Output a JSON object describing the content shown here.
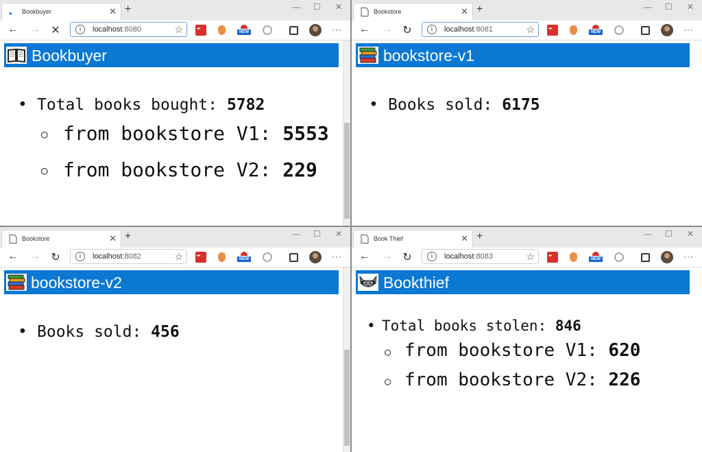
{
  "windows": [
    {
      "id": "bookbuyer",
      "tab_title": "Bookbuyer",
      "url_host": "localhost",
      "url_port": ":8080",
      "banner_title": "Bookbuyer",
      "banner_icon": "book-icon",
      "nav_state": "loading",
      "lines": [
        {
          "label": "Total books bought: ",
          "value": "5782"
        },
        {
          "label": "from bookstore V1: ",
          "value": "5553"
        },
        {
          "label": "from bookstore V2: ",
          "value": "229"
        }
      ]
    },
    {
      "id": "bookstore-v1",
      "tab_title": "Bookstore",
      "url_host": "localhost",
      "url_port": ":8081",
      "banner_title": "bookstore-v1",
      "banner_icon": "books-stack-icon",
      "nav_state": "idle",
      "lines": [
        {
          "label": "Books sold: ",
          "value": "6175"
        }
      ]
    },
    {
      "id": "bookstore-v2",
      "tab_title": "Bookstore",
      "url_host": "localhost",
      "url_port": ":8082",
      "banner_title": "bookstore-v2",
      "banner_icon": "books-stack-icon",
      "nav_state": "idle",
      "lines": [
        {
          "label": "Books sold: ",
          "value": "456"
        }
      ]
    },
    {
      "id": "bookthief",
      "tab_title": "Book Thief",
      "url_host": "localhost",
      "url_port": ":8083",
      "banner_title": "Bookthief",
      "banner_icon": "raccoon-icon",
      "nav_state": "idle",
      "lines": [
        {
          "label": "Total books stolen: ",
          "value": "846"
        },
        {
          "label": "from bookstore V1: ",
          "value": "620"
        },
        {
          "label": "from bookstore V2: ",
          "value": "226"
        }
      ]
    }
  ],
  "toolbar": {
    "new_badge": "NEW",
    "new_tab_symbol": "+",
    "menu_symbol": "···"
  },
  "colors": {
    "banner": "#0b78d4",
    "banner_text": "#ffffff",
    "page_bg": "#ffffff"
  }
}
